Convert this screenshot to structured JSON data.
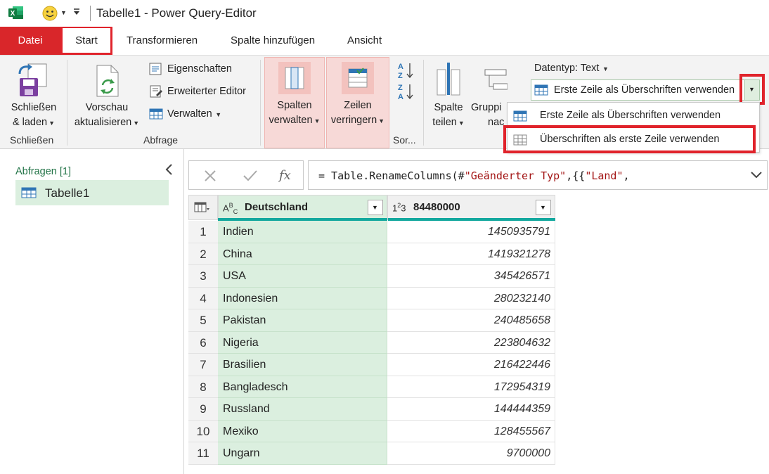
{
  "window": {
    "title": "Tabelle1 - Power Query-Editor"
  },
  "tabs": [
    "Datei",
    "Start",
    "Transformieren",
    "Spalte hinzufügen",
    "Ansicht"
  ],
  "ribbon": {
    "schliessen": {
      "button_line1": "Schließen",
      "button_line2": "& laden",
      "group_label": "Schließen"
    },
    "abfrage": {
      "vorschau_line1": "Vorschau",
      "vorschau_line2": "aktualisieren",
      "eigenschaften": "Eigenschaften",
      "erweiterter_editor": "Erweiterter Editor",
      "verwalten": "Verwalten",
      "group_label": "Abfrage"
    },
    "spalten_line1": "Spalten",
    "spalten_line2": "verwalten",
    "zeilen_line1": "Zeilen",
    "zeilen_line2": "verringern",
    "sort_group_label": "Sor...",
    "spalte_teilen_line1": "Spalte",
    "spalte_teilen_line2": "teilen",
    "gruppieren_line1": "Gruppi",
    "gruppieren_line2": "nac",
    "datentyp": "Datentyp: Text",
    "combo_label": "Erste Zeile als Überschriften verwenden",
    "menu_items": [
      "Erste Zeile als Überschriften verwenden",
      "Überschriften als erste Zeile verwenden"
    ]
  },
  "left_panel": {
    "header": "Abfragen [1]",
    "queries": [
      "Tabelle1"
    ]
  },
  "formula_bar": {
    "prefix": "= Table.RenameColumns(#",
    "str1": "\"Geänderter Typ\"",
    "mid": ",{{",
    "str2": "\"Land\"",
    "suffix": ","
  },
  "grid": {
    "columns": [
      {
        "type": "ABC",
        "name": "Deutschland"
      },
      {
        "type": "123",
        "name": "84480000"
      }
    ],
    "rows": [
      {
        "n": "1",
        "a": "Indien",
        "b": "1450935791"
      },
      {
        "n": "2",
        "a": "China",
        "b": "1419321278"
      },
      {
        "n": "3",
        "a": "USA",
        "b": "345426571"
      },
      {
        "n": "4",
        "a": "Indonesien",
        "b": "280232140"
      },
      {
        "n": "5",
        "a": "Pakistan",
        "b": "240485658"
      },
      {
        "n": "6",
        "a": "Nigeria",
        "b": "223804632"
      },
      {
        "n": "7",
        "a": "Brasilien",
        "b": "216422446"
      },
      {
        "n": "8",
        "a": "Bangladesch",
        "b": "172954319"
      },
      {
        "n": "9",
        "a": "Russland",
        "b": "144444359"
      },
      {
        "n": "10",
        "a": "Mexiko",
        "b": "128455567"
      },
      {
        "n": "11",
        "a": "Ungarn",
        "b": "9700000"
      }
    ]
  },
  "colors": {
    "accent_red": "#d9262a",
    "highlight_red": "#e0232b",
    "column_green": "#dbefdf",
    "header_line": "#13a89e"
  }
}
